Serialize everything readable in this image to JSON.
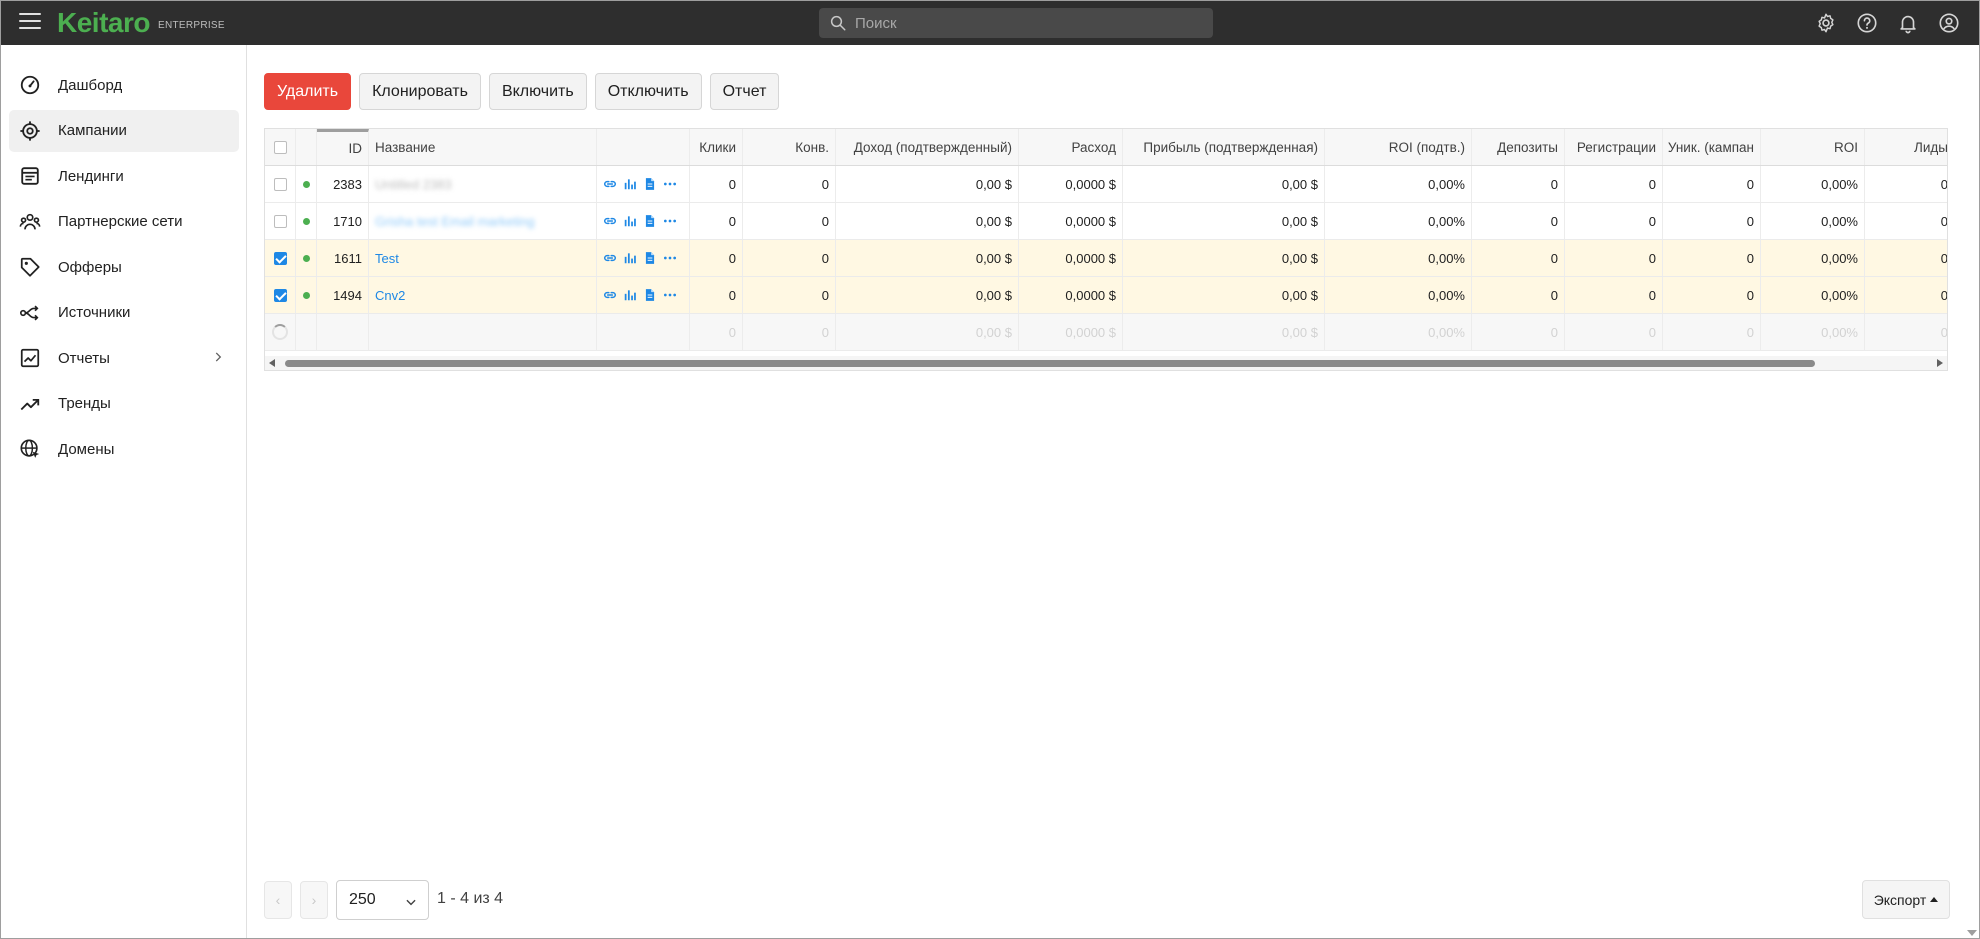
{
  "app": {
    "logo": "Keitaro",
    "edition": "ENTERPRISE",
    "accent_color": "#4caf50",
    "link_color": "#1e88e5",
    "danger_color": "#e9473b"
  },
  "search": {
    "placeholder": "Поиск"
  },
  "top_icons": [
    "gear-icon",
    "help-icon",
    "bell-icon",
    "account-icon"
  ],
  "sidebar": {
    "items": [
      {
        "label": "Дашборд",
        "icon": "dashboard-icon",
        "active": false
      },
      {
        "label": "Кампании",
        "icon": "target-icon",
        "active": true
      },
      {
        "label": "Лендинги",
        "icon": "landing-icon",
        "active": false
      },
      {
        "label": "Партнерские сети",
        "icon": "affiliate-network-icon",
        "active": false
      },
      {
        "label": "Офферы",
        "icon": "tag-icon",
        "active": false
      },
      {
        "label": "Источники",
        "icon": "sources-icon",
        "active": false
      },
      {
        "label": "Отчеты",
        "icon": "reports-icon",
        "active": false,
        "expandable": true
      },
      {
        "label": "Тренды",
        "icon": "trend-icon",
        "active": false
      },
      {
        "label": "Домены",
        "icon": "globe-icon",
        "active": false
      }
    ]
  },
  "toolbar": {
    "delete": "Удалить",
    "clone": "Клонировать",
    "enable": "Включить",
    "disable": "Отключить",
    "report": "Отчет"
  },
  "table": {
    "columns": {
      "id": "ID",
      "name": "Название",
      "clicks": "Клики",
      "conv": "Конв.",
      "revenue": "Доход (подтвержденный)",
      "cost": "Расход",
      "profit": "Прибыль (подтвержденная)",
      "roi_conf": "ROI (подтв.)",
      "deposits": "Депозиты",
      "registrations": "Регистрации",
      "uniques": "Уник. (кампан",
      "roi": "ROI",
      "leads": "Лиды"
    },
    "rows": [
      {
        "id": "2383",
        "name": "Untitled 2383",
        "name_blurred": true,
        "checked": false,
        "clicks": "0",
        "conv": "0",
        "revenue": "0,00 $",
        "cost": "0,0000 $",
        "profit": "0,00 $",
        "roi_conf": "0,00%",
        "deposits": "0",
        "registrations": "0",
        "uniques": "0",
        "roi": "0,00%",
        "leads": "0"
      },
      {
        "id": "1710",
        "name": "Grisha test Email marketing",
        "name_blurred": true,
        "checked": false,
        "clicks": "0",
        "conv": "0",
        "revenue": "0,00 $",
        "cost": "0,0000 $",
        "profit": "0,00 $",
        "roi_conf": "0,00%",
        "deposits": "0",
        "registrations": "0",
        "uniques": "0",
        "roi": "0,00%",
        "leads": "0"
      },
      {
        "id": "1611",
        "name": "Test",
        "name_blurred": false,
        "checked": true,
        "clicks": "0",
        "conv": "0",
        "revenue": "0,00 $",
        "cost": "0,0000 $",
        "profit": "0,00 $",
        "roi_conf": "0,00%",
        "deposits": "0",
        "registrations": "0",
        "uniques": "0",
        "roi": "0,00%",
        "leads": "0"
      },
      {
        "id": "1494",
        "name": "Cnv2",
        "name_blurred": false,
        "checked": true,
        "clicks": "0",
        "conv": "0",
        "revenue": "0,00 $",
        "cost": "0,0000 $",
        "profit": "0,00 $",
        "roi_conf": "0,00%",
        "deposits": "0",
        "registrations": "0",
        "uniques": "0",
        "roi": "0,00%",
        "leads": "0"
      }
    ],
    "totals": {
      "clicks": "0",
      "conv": "0",
      "revenue": "0,00 $",
      "cost": "0,0000 $",
      "profit": "0,00 $",
      "roi_conf": "0,00%",
      "deposits": "0",
      "registrations": "0",
      "uniques": "0",
      "roi": "0,00%",
      "leads": "0"
    }
  },
  "footer": {
    "per_page": "250",
    "range": "1 - 4 из 4",
    "export": "Экспорт"
  }
}
